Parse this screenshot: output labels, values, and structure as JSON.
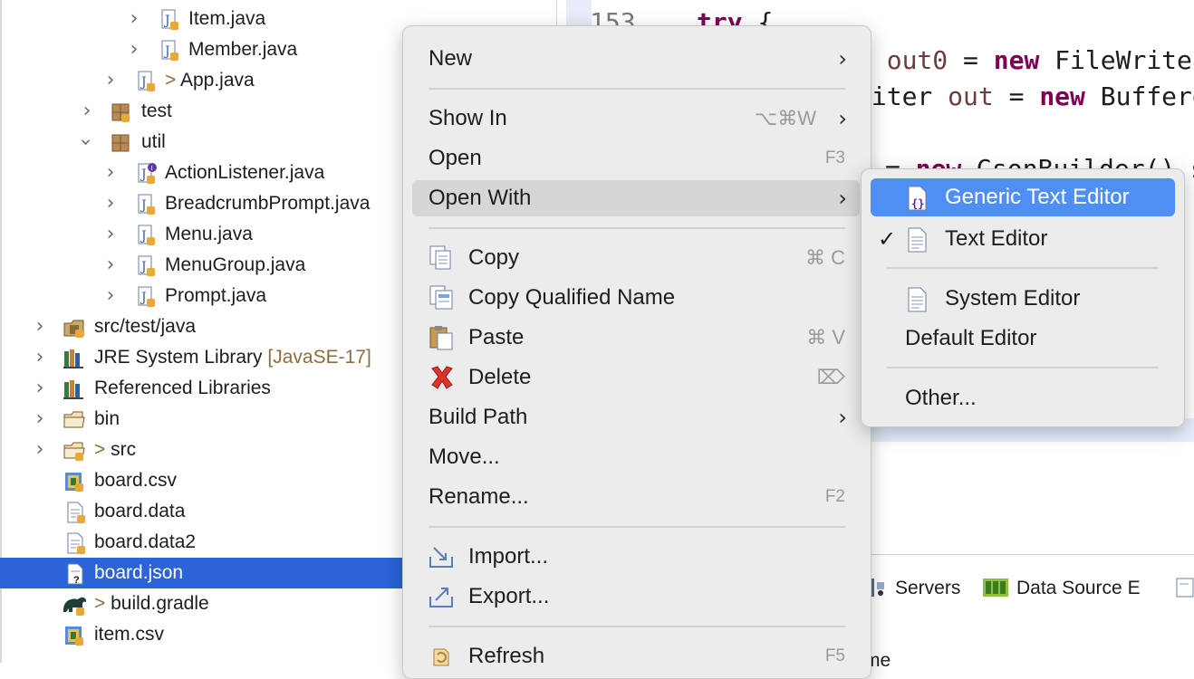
{
  "tree": {
    "rows": [
      {
        "label": "Item.java",
        "icon": "java-class-icon"
      },
      {
        "label": "Member.java",
        "icon": "java-class-icon"
      },
      {
        "prefix": "> ",
        "label": "App.java",
        "icon": "java-class-icon"
      },
      {
        "label": "test",
        "icon": "package-icon"
      },
      {
        "label": "util",
        "icon": "package-icon"
      },
      {
        "label": "ActionListener.java",
        "icon": "java-interface-icon"
      },
      {
        "label": "BreadcrumbPrompt.java",
        "icon": "java-class-icon"
      },
      {
        "label": "Menu.java",
        "icon": "java-class-icon"
      },
      {
        "label": "MenuGroup.java",
        "icon": "java-class-icon"
      },
      {
        "label": "Prompt.java",
        "icon": "java-class-icon"
      },
      {
        "label": "src/test/java",
        "icon": "source-folder-icon"
      },
      {
        "label": "JRE System Library",
        "suffix": "[JavaSE-17]",
        "icon": "library-icon"
      },
      {
        "label": "Referenced Libraries",
        "icon": "library-icon"
      },
      {
        "label": "bin",
        "icon": "folder-icon"
      },
      {
        "prefix": "> ",
        "label": "src",
        "icon": "folder-icon"
      },
      {
        "label": "board.csv",
        "icon": "csv-file-icon"
      },
      {
        "label": "board.data",
        "icon": "file-icon"
      },
      {
        "label": "board.data2",
        "icon": "file-icon"
      },
      {
        "label": "board.json",
        "icon": "unknown-file-icon",
        "selected": true
      },
      {
        "prefix": "> ",
        "label": "build.gradle",
        "icon": "gradle-icon"
      },
      {
        "label": "item.csv",
        "icon": "csv-file-icon"
      }
    ]
  },
  "editor": {
    "line_number": "153",
    "try_kw": "try",
    "try_brace": " {",
    "l1_a": "r ",
    "l1_var": "out0",
    "l1_eq": " = ",
    "l1_kw": "new",
    "l1_b": " FileWriter",
    "l2_a": "riter ",
    "l2_var": "out",
    "l2_eq": " = ",
    "l2_kw": "new",
    "l2_b": " Buffere",
    "l3_a": "= ",
    "l3_kw": "new",
    "l3_b": " GsonBuilder().se"
  },
  "bottom_tabs": [
    {
      "label": "Servers",
      "icon": "servers-icon"
    },
    {
      "label": "Data Source E",
      "icon": "data-source-icon"
    }
  ],
  "bottom_fragment": "me",
  "context_menu": {
    "items": [
      {
        "label": "New",
        "submenu": true
      },
      {
        "label": "Show In",
        "shortcut": "⌥⌘W",
        "submenu": true
      },
      {
        "label": "Open",
        "shortcut": "F3"
      },
      {
        "label": "Open With",
        "submenu": true,
        "hover": true
      },
      {
        "label": "Copy",
        "shortcut": "⌘ C",
        "icon": "copy-icon"
      },
      {
        "label": "Copy Qualified Name",
        "icon": "copy-qualified-name-icon"
      },
      {
        "label": "Paste",
        "shortcut": "⌘ V",
        "icon": "paste-icon"
      },
      {
        "label": "Delete",
        "shortcut": "⌦",
        "icon": "delete-icon"
      },
      {
        "label": "Build Path",
        "submenu": true
      },
      {
        "label": "Move..."
      },
      {
        "label": "Rename...",
        "shortcut": "F2"
      },
      {
        "label": "Import...",
        "icon": "import-icon"
      },
      {
        "label": "Export...",
        "icon": "export-icon"
      },
      {
        "label": "Refresh",
        "shortcut": "F5",
        "icon": "refresh-icon"
      }
    ]
  },
  "open_with_submenu": {
    "items": [
      {
        "label": "Generic Text Editor",
        "icon": "generic-text-editor-icon",
        "active": true
      },
      {
        "label": "Text Editor",
        "icon": "text-editor-icon",
        "checked": true,
        "check_mark": "✓"
      },
      {
        "label": "System Editor",
        "icon": "system-editor-icon"
      },
      {
        "label": "Default Editor"
      },
      {
        "label": "Other..."
      }
    ]
  },
  "colors": {
    "selection": "#2b63d9",
    "submenu_active": "#4f8ff3",
    "keyword": "#7f0055",
    "variable": "#6a3e3e",
    "delete_red": "#d9342b"
  }
}
